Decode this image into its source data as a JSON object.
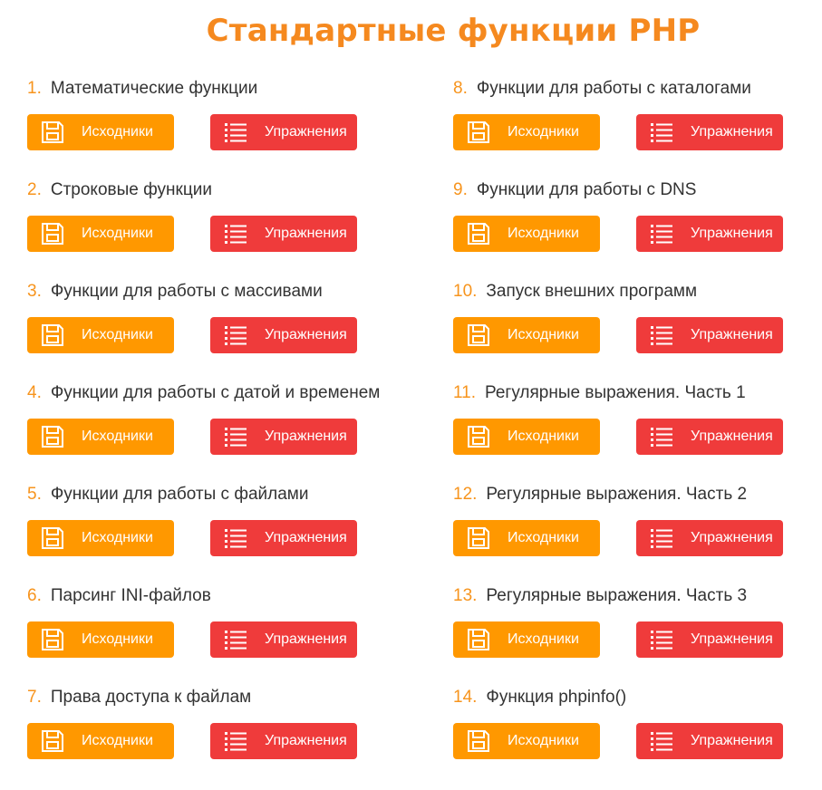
{
  "page": {
    "title": "Стандартные функции PHP"
  },
  "buttons": {
    "sources_label": "Исходники",
    "exercises_label": "Упражнения"
  },
  "icons": {
    "sources": "floppy-disk-icon",
    "exercises": "list-icon"
  },
  "colors": {
    "title": "#f5891f",
    "number": "#f7941d",
    "sources_button": "#ff9800",
    "exercises_button": "#ef3b3b",
    "text": "#333333"
  },
  "items": [
    {
      "num": "1.",
      "title": "Математические функции"
    },
    {
      "num": "2.",
      "title": "Строковые функции"
    },
    {
      "num": "3.",
      "title": "Функции для работы с массивами"
    },
    {
      "num": "4.",
      "title": "Функции для работы с датой и временем"
    },
    {
      "num": "5.",
      "title": "Функции для работы с файлами"
    },
    {
      "num": "6.",
      "title": "Парсинг INI-файлов"
    },
    {
      "num": "7.",
      "title": "Права доступа к файлам"
    },
    {
      "num": "8.",
      "title": "Функции для работы с каталогами"
    },
    {
      "num": "9.",
      "title": "Функции для работы с DNS"
    },
    {
      "num": "10.",
      "title": "Запуск внешних программ"
    },
    {
      "num": "11.",
      "title": "Регулярные выражения. Часть 1"
    },
    {
      "num": "12.",
      "title": "Регулярные выражения. Часть 2"
    },
    {
      "num": "13.",
      "title": "Регулярные выражения. Часть 3"
    },
    {
      "num": "14.",
      "title": "Функция phpinfo()"
    }
  ]
}
